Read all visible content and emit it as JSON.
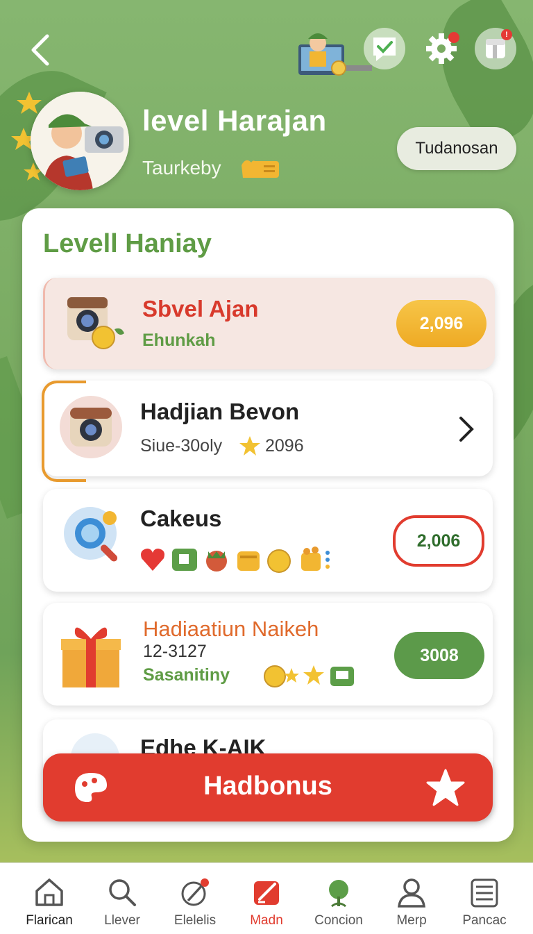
{
  "header": {
    "profile_name": "level Harajan",
    "profile_sub": "Taurkeby",
    "action_pill": "Tudanosan"
  },
  "panel": {
    "title": "Levell Haniay",
    "cards": [
      {
        "title": "Sbvel Ajan",
        "subtitle": "Ehunkah",
        "value": "2,096"
      },
      {
        "title": "Hadjian Bevon",
        "subtitle": "Siue-30oly",
        "value": "2096"
      },
      {
        "title": "Cakeus",
        "value": "2,006"
      },
      {
        "title": "Hadiaatiun Naikeh",
        "code": "12-3127",
        "subtitle": "Sasanitiny",
        "value": "3008"
      },
      {
        "title": "Edhe K-AIK"
      }
    ],
    "cta_label": "Hadbonus"
  },
  "nav": [
    {
      "label": "Flarican",
      "icon": "home-icon"
    },
    {
      "label": "Llever",
      "icon": "search-icon"
    },
    {
      "label": "Elelelis",
      "icon": "brush-icon"
    },
    {
      "label": "Madn",
      "icon": "edit-icon",
      "active": true
    },
    {
      "label": "Concion",
      "icon": "plant-icon"
    },
    {
      "label": "Merp",
      "icon": "person-icon"
    },
    {
      "label": "Pancac",
      "icon": "list-icon"
    }
  ],
  "colors": {
    "accent_green": "#5f9c45",
    "accent_red": "#e13c2f",
    "gold": "#f2b632",
    "active_nav": "#e13c2f"
  }
}
